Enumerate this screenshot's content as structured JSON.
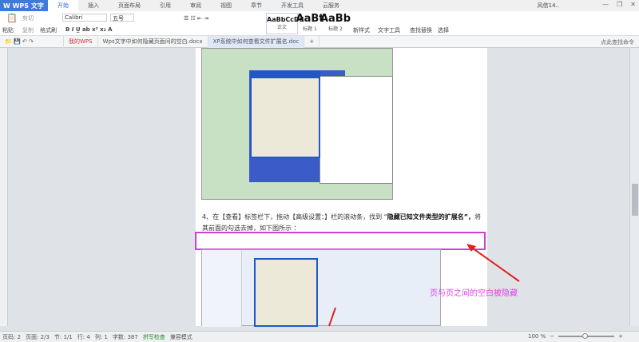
{
  "app": {
    "logo": "W WPS 文字",
    "menu_tabs": [
      "开始",
      "插入",
      "页面布局",
      "引用",
      "审阅",
      "视图",
      "章节",
      "开发工具",
      "云服务"
    ],
    "user": "风信14..",
    "active_tab": "开始"
  },
  "ribbon": {
    "paste": "粘贴",
    "cut": "剪切",
    "copy": "复制",
    "format_painter": "格式刷",
    "font": "Calibri",
    "size": "五号",
    "styles": [
      {
        "preview": "AaBbCcDd",
        "name": "正文"
      },
      {
        "preview": "AaBt",
        "name": "标题 1"
      },
      {
        "preview": "AaBb",
        "name": "标题 2"
      }
    ],
    "new_style": "新样式",
    "text_tools": "文字工具",
    "find_replace": "查找替换",
    "select": "选择"
  },
  "doc_tabs": [
    {
      "label": "我的WPS"
    },
    {
      "label": "Wps文字中如何隐藏页面间的空白.docx"
    },
    {
      "label": "XP系统中如何查看文件扩展名.doc"
    }
  ],
  "search_placeholder": "点此查找命令",
  "document": {
    "para_pre": "4、在【查看】标签栏下，拖动【高级设置：】栏的滚动条，找到 “",
    "para_bold": "隐藏已知文件类型的扩展名”，",
    "para_post": "将其前面的勾选去掉，如下图所示 ：",
    "annotation": "页与页之间的空白被隐藏"
  },
  "status": {
    "page": "页码: 2",
    "pages": "页面: 2/3",
    "section": "节: 1/1",
    "row": "行: 4",
    "col": "列: 1",
    "words": "字数: 387",
    "spell": "拼写检查",
    "compat": "兼容模式",
    "zoom": "100 %"
  }
}
